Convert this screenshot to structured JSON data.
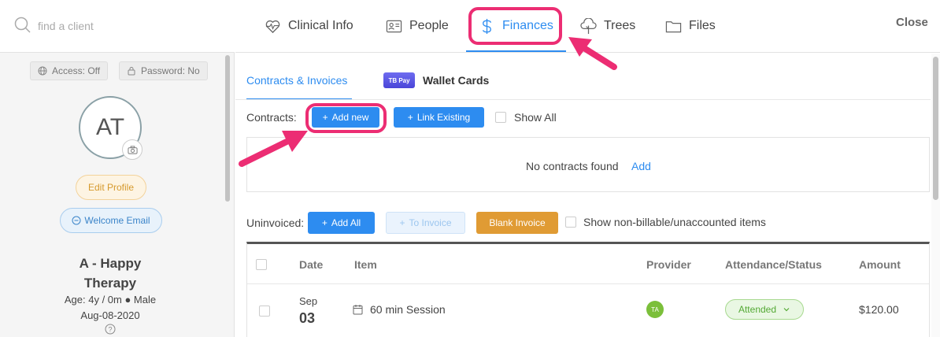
{
  "search": {
    "placeholder": "find a client"
  },
  "sidebar": {
    "access_label": "Access: Off",
    "password_label": "Password: No",
    "avatar_initials": "AT",
    "edit_profile_label": "Edit Profile",
    "welcome_email_label": "Welcome Email",
    "client_name_line1": "A - Happy",
    "client_name_line2": "Therapy",
    "age_line": "Age: 4y / 0m ● Male",
    "dob": "Aug-08-2020"
  },
  "nav": {
    "tabs": [
      {
        "label": "Clinical Info",
        "icon": "heartbeat-icon"
      },
      {
        "label": "People",
        "icon": "contact-card-icon"
      },
      {
        "label": "Finances",
        "icon": "dollar-icon",
        "active": true
      },
      {
        "label": "Trees",
        "icon": "tree-icon"
      },
      {
        "label": "Files",
        "icon": "folder-icon"
      }
    ],
    "close_label": "Close"
  },
  "finances": {
    "subtabs": [
      {
        "label": "Contracts & Invoices",
        "active": true
      },
      {
        "label": "Wallet Cards",
        "badge": "TB Pay"
      }
    ],
    "contracts": {
      "label": "Contracts:",
      "add_new_label": "Add new",
      "link_existing_label": "Link Existing",
      "show_all_label": "Show All",
      "empty_message": "No contracts found",
      "add_link_label": "Add"
    },
    "uninvoiced": {
      "label": "Uninvoiced:",
      "add_all_label": "Add All",
      "to_invoice_label": "To Invoice",
      "blank_invoice_label": "Blank Invoice",
      "show_nonbillable_label": "Show non-billable/unaccounted items"
    },
    "table": {
      "headers": [
        "Date",
        "Item",
        "Provider",
        "Attendance/Status",
        "Amount"
      ],
      "rows": [
        {
          "month": "Sep",
          "day": "03",
          "item": "60 min Session",
          "provider_initials": "TA",
          "status": "Attended",
          "amount": "$120.00"
        }
      ]
    }
  },
  "colors": {
    "accent": "#2d8cf0",
    "highlight": "#ec2d73",
    "warning": "#e09b34",
    "success": "#54a935"
  }
}
